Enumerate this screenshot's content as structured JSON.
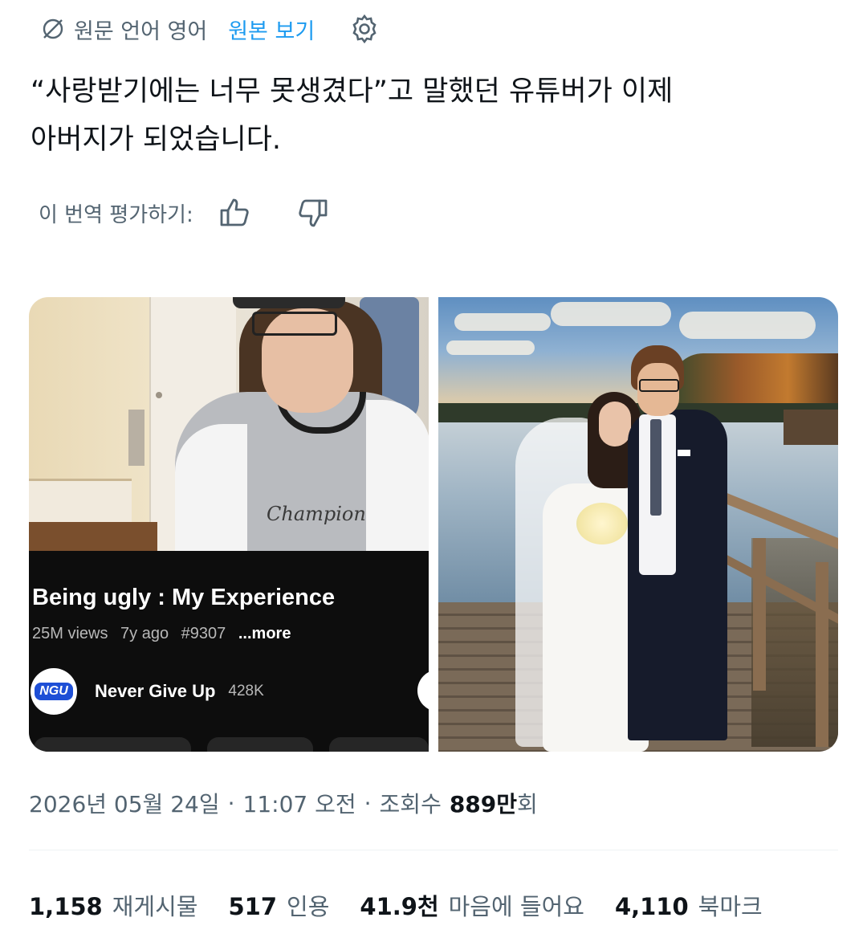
{
  "translation_bar": {
    "original_language_text": "원문 언어 영어",
    "view_original_link": "원본 보기",
    "icons": {
      "globe": "globe-slash-icon",
      "settings": "gear-icon"
    }
  },
  "tweet": {
    "text_line1": "“사랑받기에는 너무 못생겼다”고 말했던 유튜버가 이제",
    "text_line2": "아버지가 되었습니다."
  },
  "rate_translation": {
    "label": "이 번역 평가하기:",
    "icons": {
      "up": "thumbs-up-icon",
      "down": "thumbs-down-icon"
    }
  },
  "media": {
    "left": {
      "shirt_brand": "Champion",
      "video_title": "Being ugly : My Experience",
      "views": "25M views",
      "age": "7y ago",
      "tag": "#9307",
      "more": "...more",
      "channel_logo": "NGU",
      "channel_name": "Never Give Up",
      "subscribers": "428K"
    },
    "right": {
      "description_icon": "wedding-photo"
    }
  },
  "timestamp": {
    "date": "2026년 05월 24일",
    "separator": "·",
    "time": "11:07 오전",
    "views_label": "조회수",
    "views_value": "889만",
    "views_suffix": "회"
  },
  "stats": {
    "reposts": {
      "value": "1,158",
      "label": "재게시물"
    },
    "quotes": {
      "value": "517",
      "label": "인용"
    },
    "likes": {
      "value": "41.9천",
      "label": "마음에 들어요"
    },
    "bookmarks": {
      "value": "4,110",
      "label": "북마크"
    }
  },
  "colors": {
    "link": "#1d9bf0",
    "muted": "#536471",
    "text": "#0f1419"
  }
}
